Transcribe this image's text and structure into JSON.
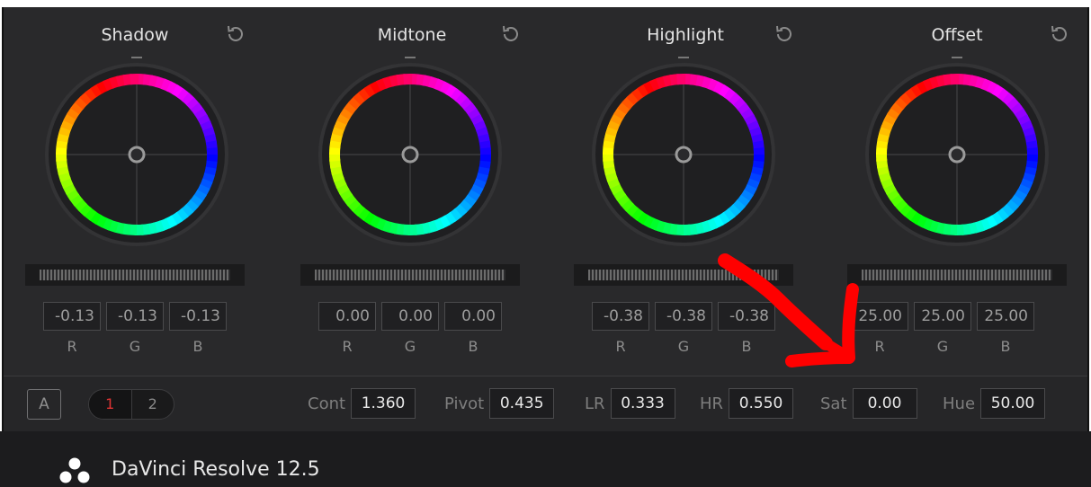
{
  "wheels": [
    {
      "title": "Shadow",
      "values": [
        "-0.13",
        "-0.13",
        "-0.13"
      ]
    },
    {
      "title": "Midtone",
      "values": [
        "0.00",
        "0.00",
        "0.00"
      ]
    },
    {
      "title": "Highlight",
      "values": [
        "-0.38",
        "-0.38",
        "-0.38"
      ]
    },
    {
      "title": "Offset",
      "values": [
        "25.00",
        "25.00",
        "25.00"
      ]
    }
  ],
  "channel_labels": [
    "R",
    "G",
    "B"
  ],
  "bottom": {
    "mode_button": "A",
    "pages": [
      "1",
      "2"
    ],
    "params": [
      {
        "label": "Cont",
        "value": "1.360"
      },
      {
        "label": "Pivot",
        "value": "0.435"
      },
      {
        "label": "LR",
        "value": "0.333"
      },
      {
        "label": "HR",
        "value": "0.550"
      },
      {
        "label": "Sat",
        "value": "0.00"
      },
      {
        "label": "Hue",
        "value": "50.00"
      }
    ]
  },
  "app": {
    "title": "DaVinci Resolve 12.5"
  },
  "colors": {
    "panel": "#29292b",
    "annotation_arrow": "#ff0000",
    "active_page": "#e03434"
  }
}
